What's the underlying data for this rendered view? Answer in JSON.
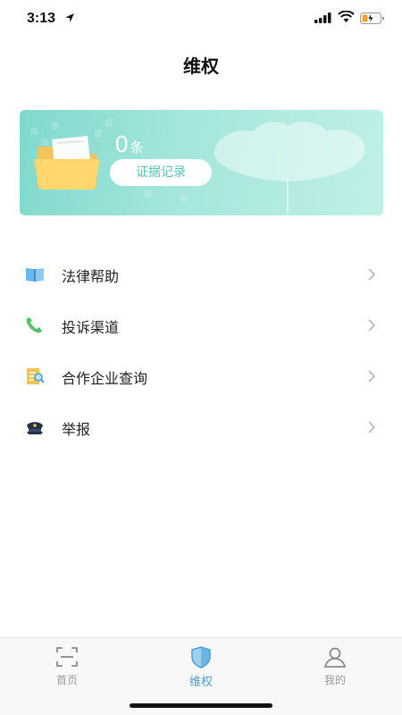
{
  "status_bar": {
    "time": "3:13"
  },
  "header": {
    "title": "维权"
  },
  "evidence_card": {
    "count": "0",
    "count_unit": "条",
    "button_label": "证据记录"
  },
  "menu": [
    {
      "label": "法律帮助",
      "icon": "book-icon"
    },
    {
      "label": "投诉渠道",
      "icon": "phone-icon"
    },
    {
      "label": "合作企业查询",
      "icon": "document-search-icon"
    },
    {
      "label": "举报",
      "icon": "police-cap-icon"
    }
  ],
  "tab_bar": {
    "tabs": [
      {
        "label": "首页",
        "icon": "scan-frame-icon",
        "active": false
      },
      {
        "label": "维权",
        "icon": "shield-icon",
        "active": true
      },
      {
        "label": "我的",
        "icon": "user-icon",
        "active": false
      }
    ]
  },
  "colors": {
    "accent": "#4aa0d8",
    "banner": "#8fdccf",
    "evidence_text": "#5cc2b4"
  }
}
